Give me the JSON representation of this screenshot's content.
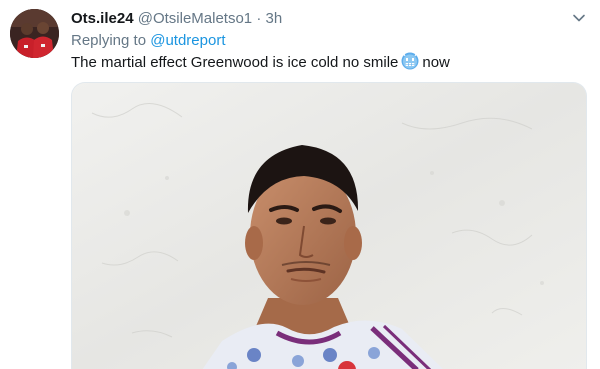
{
  "tweet": {
    "display_name": "Ots.ile24",
    "handle": "@OtsileMaletso1",
    "separator": "·",
    "time": "3h",
    "replying_prefix": "Replying to",
    "replying_to": "@utdreport",
    "text_before_emoji": "The martial effect Greenwood is ice cold no smile",
    "emoji_icon": "cold-face-icon",
    "text_after_emoji": "now"
  },
  "colors": {
    "link": "#1b95e0",
    "secondary_text": "#657786",
    "primary_text": "#14171a"
  }
}
